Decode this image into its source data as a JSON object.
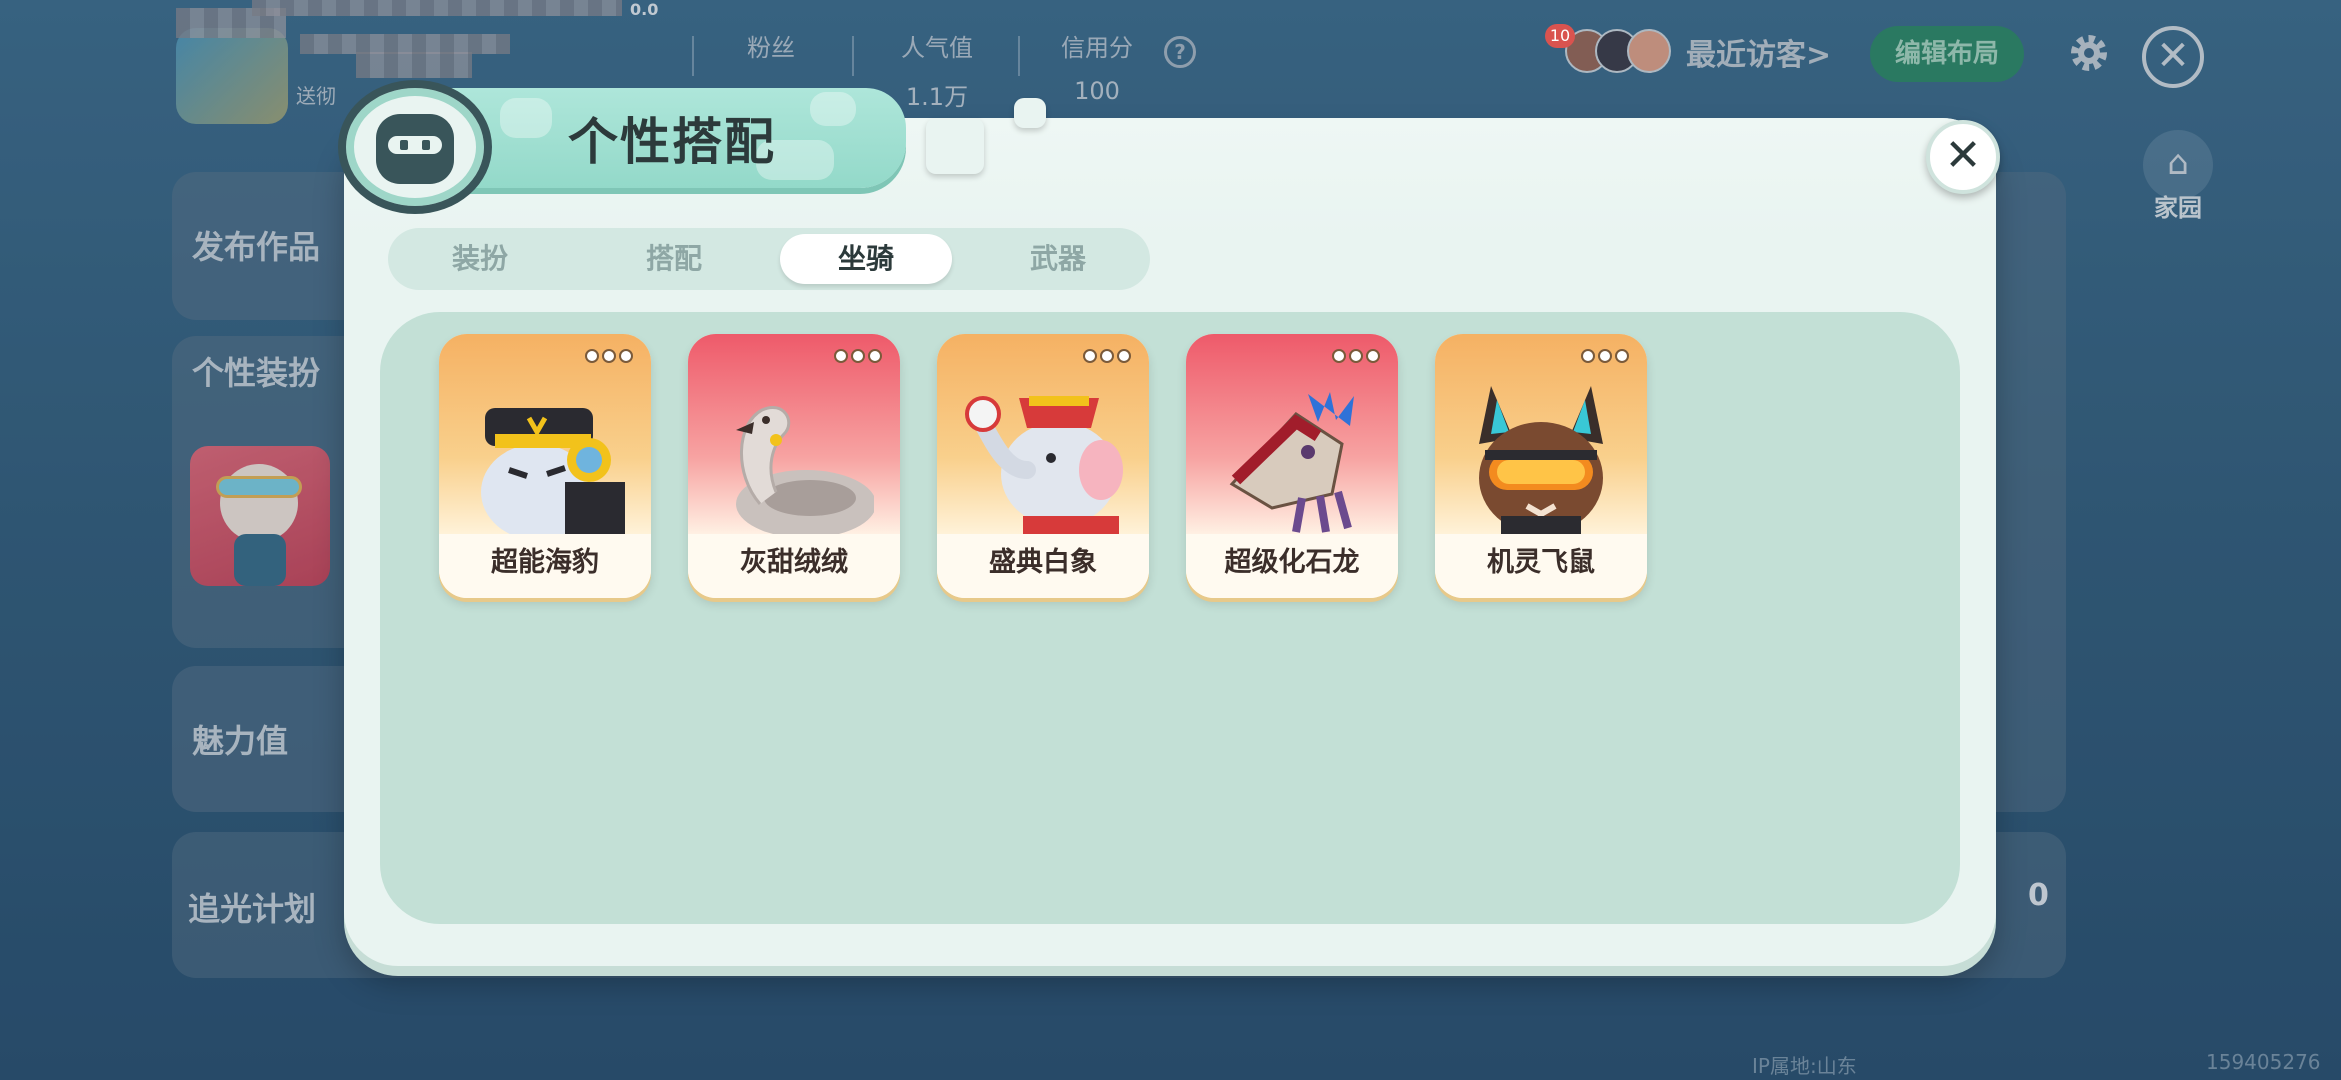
{
  "top_bar": {
    "stats": [
      {
        "label": "",
        "value": ""
      },
      {
        "label": "粉丝",
        "value": ""
      },
      {
        "label": "人气值",
        "value": "1.1万"
      },
      {
        "label": "信用分",
        "value": "100"
      }
    ],
    "version_text": "0.0",
    "player_tag": "送彻",
    "visitor_count": "10",
    "recent_visitors": "最近访客>",
    "edit_layout": "编辑布局"
  },
  "home_label": "家园",
  "background_panels": {
    "publish": "发布作品",
    "outfit": "个性装扮",
    "charm": "魅力值",
    "chase_light": "追光计划",
    "zero_value": "0",
    "bottom_text": "IP属地:山东",
    "player_id": "159405276"
  },
  "modal": {
    "title": "个性搭配",
    "tabs": [
      {
        "label": "装扮",
        "active": false
      },
      {
        "label": "搭配",
        "active": false
      },
      {
        "label": "坐骑",
        "active": true
      },
      {
        "label": "武器",
        "active": false
      }
    ],
    "mounts": [
      {
        "name": "超能海豹",
        "bg": "orange",
        "icon": "super-seal-icon"
      },
      {
        "name": "灰甜绒绒",
        "bg": "red",
        "icon": "gray-swan-icon"
      },
      {
        "name": "盛典白象",
        "bg": "orange",
        "icon": "white-elephant-icon"
      },
      {
        "name": "超级化石龙",
        "bg": "red",
        "icon": "fossil-dragon-icon"
      },
      {
        "name": "机灵飞鼠",
        "bg": "orange",
        "icon": "flying-squirrel-icon"
      }
    ]
  },
  "colors": {
    "modal_bg": "#e9f4f1",
    "content_bg": "#c3e0d6",
    "ribbon": "#93d9c9",
    "card_orange": "#f5b163",
    "card_red": "#ee5a6a"
  }
}
